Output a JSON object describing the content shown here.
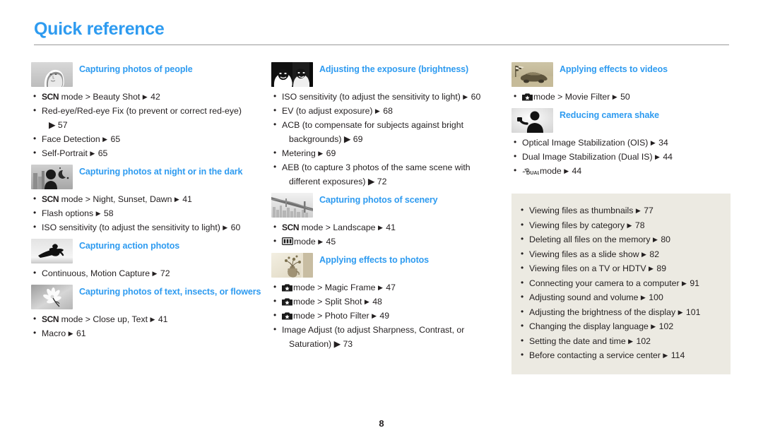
{
  "page": {
    "title": "Quick reference",
    "folio": "8",
    "accent_color": "#2e9bf0",
    "text_color": "#231f20",
    "infobox_bg": "#eceae2"
  },
  "columns": [
    {
      "sections": [
        {
          "thumb": "portrait-woman-thumbnail",
          "title": "Capturing photos of people",
          "items": [
            {
              "pre_icon": "scn-mode-icon",
              "text": "mode > Beauty Shot",
              "arrow": "▶",
              "page": "42"
            },
            {
              "text": "Red-eye/Red-eye Fix (to prevent or correct red-eye)",
              "continuation": "▶ 57"
            },
            {
              "text": "Face Detection",
              "arrow": "▶",
              "page": "65"
            },
            {
              "text": "Self-Portrait",
              "arrow": "▶",
              "page": "65"
            }
          ]
        },
        {
          "thumb": "night-scene-thumbnail",
          "title": "Capturing photos at night or in the dark",
          "items": [
            {
              "pre_icon": "scn-mode-icon",
              "text": "mode > Night, Sunset, Dawn",
              "arrow": "▶",
              "page": "41"
            },
            {
              "text": "Flash options",
              "arrow": "▶",
              "page": "58"
            },
            {
              "text": "ISO sensitivity (to adjust the sensitivity to light)",
              "arrow": "▶",
              "page": "60"
            }
          ]
        },
        {
          "thumb": "snowboarder-thumbnail",
          "title": "Capturing action photos",
          "items": [
            {
              "text": "Continuous, Motion Capture",
              "arrow": "▶",
              "page": "72"
            }
          ]
        },
        {
          "thumb": "flower-macro-thumbnail",
          "title": "Capturing photos of text, insects, or flowers",
          "items": [
            {
              "pre_icon": "scn-mode-icon",
              "text": "mode > Close up, Text",
              "arrow": "▶",
              "page": "41"
            },
            {
              "text": "Macro",
              "arrow": "▶",
              "page": "61"
            }
          ]
        }
      ]
    },
    {
      "sections": [
        {
          "thumb": "two-faces-exposure-thumbnail",
          "title": "Adjusting the exposure (brightness)",
          "items": [
            {
              "text": "ISO sensitivity (to adjust the sensitivity to light)",
              "arrow": "▶",
              "page": "60"
            },
            {
              "text": "EV (to adjust exposure)",
              "arrow": "▶",
              "page": "68"
            },
            {
              "text": "ACB (to compensate for subjects against bright",
              "continuation": "backgrounds) ▶ 69"
            },
            {
              "text": "Metering",
              "arrow": "▶",
              "page": "69"
            },
            {
              "text": "AEB (to capture 3 photos of the same scene with",
              "continuation": "different exposures) ▶ 72"
            }
          ]
        },
        {
          "thumb": "bridge-scenery-thumbnail",
          "title": "Capturing photos of scenery",
          "items": [
            {
              "pre_icon": "scn-mode-icon",
              "text": "mode > Landscape",
              "arrow": "▶",
              "page": "41"
            },
            {
              "pre_icon": "panorama-mode-icon",
              "text": "mode",
              "arrow": "▶",
              "page": "45"
            }
          ]
        },
        {
          "thumb": "vase-effects-thumbnail",
          "title": "Applying effects to photos",
          "items": [
            {
              "pre_icon": "magic-mode-icon",
              "text": "mode > Magic Frame",
              "arrow": "▶",
              "page": "47"
            },
            {
              "pre_icon": "magic-mode-icon",
              "text": "mode > Split Shot",
              "arrow": "▶",
              "page": "48"
            },
            {
              "pre_icon": "magic-mode-icon",
              "text": "mode > Photo Filter",
              "arrow": "▶",
              "page": "49"
            },
            {
              "text": "Image Adjust (to adjust Sharpness, Contrast, or",
              "continuation": "Saturation) ▶ 73"
            }
          ]
        }
      ]
    },
    {
      "sections": [
        {
          "thumb": "racecar-video-thumbnail",
          "title": "Applying effects to videos",
          "items": [
            {
              "pre_icon": "magic-mode-icon",
              "text": "mode > Movie Filter",
              "arrow": "▶",
              "page": "50"
            }
          ]
        },
        {
          "thumb": "camera-shake-thumbnail",
          "title": "Reducing camera shake",
          "items": [
            {
              "text": "Optical Image Stabilization (OIS)",
              "arrow": "▶",
              "page": "34"
            },
            {
              "text": "Dual Image Stabilization (Dual IS)",
              "arrow": "▶",
              "page": "44"
            },
            {
              "pre_icon": "dual-is-mode-icon",
              "text": "mode",
              "arrow": "▶",
              "page": "44"
            }
          ]
        }
      ],
      "infobox": {
        "items": [
          {
            "text": "Viewing files as thumbnails",
            "arrow": "▶",
            "page": "77"
          },
          {
            "text": "Viewing files by category",
            "arrow": "▶",
            "page": "78"
          },
          {
            "text": "Deleting all files on the memory",
            "arrow": "▶",
            "page": "80"
          },
          {
            "text": "Viewing files as a slide show",
            "arrow": "▶",
            "page": "82"
          },
          {
            "text": "Viewing files on a TV or HDTV",
            "arrow": "▶",
            "page": "89"
          },
          {
            "text": "Connecting your camera to a computer",
            "arrow": "▶",
            "page": "91"
          },
          {
            "text": "Adjusting sound and volume",
            "arrow": "▶",
            "page": "100"
          },
          {
            "text": "Adjusting the brightness of the display",
            "arrow": "▶",
            "page": "101"
          },
          {
            "text": "Changing the display language",
            "arrow": "▶",
            "page": "102"
          },
          {
            "text": "Setting the date and time",
            "arrow": "▶",
            "page": "102"
          },
          {
            "text": "Before contacting a service center",
            "arrow": "▶",
            "page": "114"
          }
        ]
      }
    }
  ]
}
